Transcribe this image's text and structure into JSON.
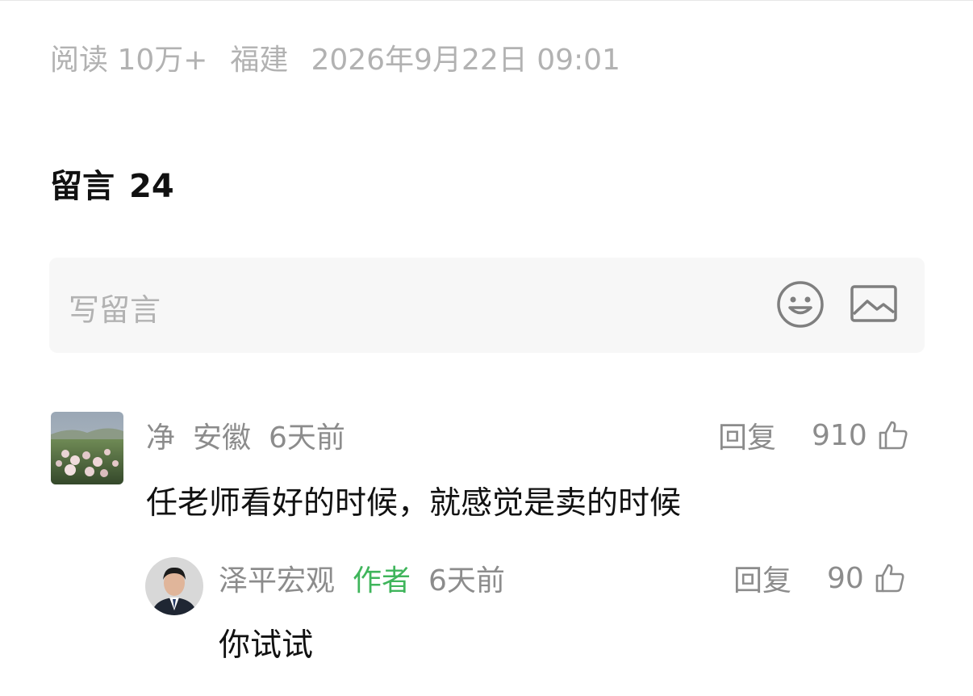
{
  "article_meta": {
    "reads": "阅读 10万+",
    "region": "福建",
    "datetime": "2026年9月22日 09:01"
  },
  "comments_section": {
    "title": "留言",
    "count": "24"
  },
  "composer": {
    "placeholder": "写留言",
    "emoji_icon": "smiley-face-icon",
    "image_icon": "image-icon"
  },
  "comments": [
    {
      "name": "净",
      "region": "安徽",
      "time": "6天前",
      "reply_label": "回复",
      "likes": "910",
      "text": "任老师看好的时候，就感觉是卖的时候",
      "avatar": "flower-field-photo"
    },
    {
      "name": "泽平宏观",
      "badge": "作者",
      "time": "6天前",
      "reply_label": "回复",
      "likes": "90",
      "text": "你试试",
      "avatar": "person-portrait-photo"
    }
  ],
  "colors": {
    "meta_text": "#b2b2b2",
    "secondary_text": "#8c8c8c",
    "author_green": "#3fb55b",
    "primary_text": "#111111",
    "compose_bg": "#f7f7f7"
  }
}
